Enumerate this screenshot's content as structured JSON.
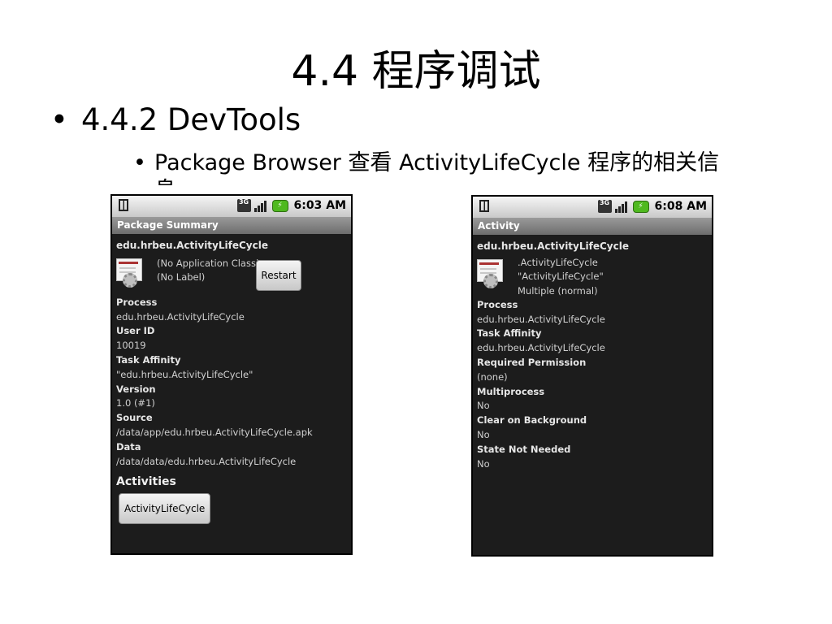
{
  "slide": {
    "title": "4.4  程序调试",
    "bullet1": "4.4.2 DevTools",
    "bullet2": "Package Browser 查看 ActivityLifeCycle 程序的相关信",
    "bullet2_wrap": "息"
  },
  "left_phone": {
    "status_time": "6:03 AM",
    "network_label": "3G",
    "title_bar": "Package Summary",
    "package_name": "edu.hrbeu.ActivityLifeCycle",
    "app_class": "(No Application Class)",
    "app_label": "(No Label)",
    "restart_label": "Restart",
    "fields": [
      {
        "label": "Process",
        "value": "edu.hrbeu.ActivityLifeCycle"
      },
      {
        "label": "User ID",
        "value": "10019"
      },
      {
        "label": "Task Affinity",
        "value": "\"edu.hrbeu.ActivityLifeCycle\""
      },
      {
        "label": "Version",
        "value": "1.0 (#1)"
      },
      {
        "label": "Source",
        "value": "/data/app/edu.hrbeu.ActivityLifeCycle.apk"
      },
      {
        "label": "Data",
        "value": "/data/data/edu.hrbeu.ActivityLifeCycle"
      }
    ],
    "activities_heading": "Activities",
    "activity_button": "ActivityLifeCycle"
  },
  "right_phone": {
    "status_time": "6:08 AM",
    "network_label": "3G",
    "title_bar": "Activity",
    "package_name": "edu.hrbeu.ActivityLifeCycle",
    "activity_class": ".ActivityLifeCycle",
    "activity_label": "\"ActivityLifeCycle\"",
    "launch_mode": "Multiple (normal)",
    "fields": [
      {
        "label": "Process",
        "value": "edu.hrbeu.ActivityLifeCycle"
      },
      {
        "label": "Task Affinity",
        "value": "edu.hrbeu.ActivityLifeCycle"
      },
      {
        "label": "Required Permission",
        "value": "(none)"
      },
      {
        "label": "Multiprocess",
        "value": "No"
      },
      {
        "label": "Clear on Background",
        "value": "No"
      },
      {
        "label": "State Not Needed",
        "value": "No"
      }
    ]
  },
  "colors": {
    "screen_bg": "#1c1c1c",
    "title_bar": "#7f7f7f",
    "battery_green": "#4fb91f"
  }
}
